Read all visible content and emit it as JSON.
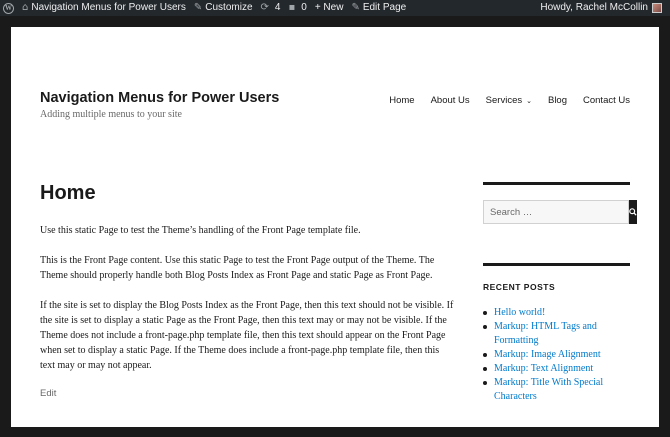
{
  "admin_bar": {
    "site_name": "Navigation Menus for Power Users",
    "customize": "Customize",
    "updates_count": "4",
    "comments_count": "0",
    "new_label": "+ New",
    "edit_page": "Edit Page",
    "howdy": "Howdy, Rachel McCollin"
  },
  "header": {
    "site_title": "Navigation Menus for Power Users",
    "site_description": "Adding multiple menus to your site",
    "nav": [
      {
        "label": "Home"
      },
      {
        "label": "About Us"
      },
      {
        "label": "Services"
      },
      {
        "label": "Blog"
      },
      {
        "label": "Contact Us"
      }
    ]
  },
  "content": {
    "title": "Home",
    "paragraphs": [
      "Use this static Page to test the Theme’s handling of the Front Page template file.",
      "This is the Front Page content. Use this static Page to test the Front Page output of the Theme. The Theme should properly handle both Blog Posts Index as Front Page and static Page as Front Page.",
      "If the site is set to display the Blog Posts Index as the Front Page, then this text should not be visible. If the site is set to display a static Page as the Front Page, then this text may or may not be visible. If the Theme does not include a front-page.php template file, then this text should appear on the Front Page when set to display a static Page. If the Theme does include a front-page.php template file, then this text may or may not appear."
    ],
    "edit_link": "Edit"
  },
  "sidebar": {
    "search_placeholder": "Search …",
    "recent_posts_title": "RECENT POSTS",
    "recent_posts": [
      "Hello world!",
      "Markup: HTML Tags and Formatting",
      "Markup: Image Alignment",
      "Markup: Text Alignment",
      "Markup: Title With Special Characters"
    ]
  },
  "colors": {
    "admin_bar_bg": "#23282d",
    "link": "#007acc",
    "text": "#1a1a1a"
  }
}
